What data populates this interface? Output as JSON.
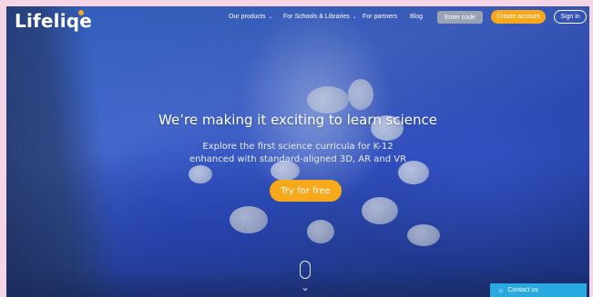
{
  "brand": {
    "name": "Lifeliqe",
    "accent": "#f7a81b"
  },
  "nav": {
    "items": [
      {
        "label": "Our products",
        "has_dropdown": true
      },
      {
        "label": "For Schools & Libraries",
        "has_dropdown": true
      },
      {
        "label": "For partners",
        "has_dropdown": false
      },
      {
        "label": "Blog",
        "has_dropdown": false
      }
    ],
    "enter_code": "Enter code",
    "create_account": "Create account",
    "sign_in": "Sign in"
  },
  "hero": {
    "headline": "We’re making it exciting to learn science",
    "sub_line1": "Explore the first science curricula for K-12",
    "sub_line2": "enhanced with standard-aligned 3D, AR and VR",
    "cta": "Try for free",
    "scroll_icon": "mouse-scroll-icon"
  },
  "contact_widget": {
    "label": "Contact us",
    "icon": "chat-icon"
  }
}
